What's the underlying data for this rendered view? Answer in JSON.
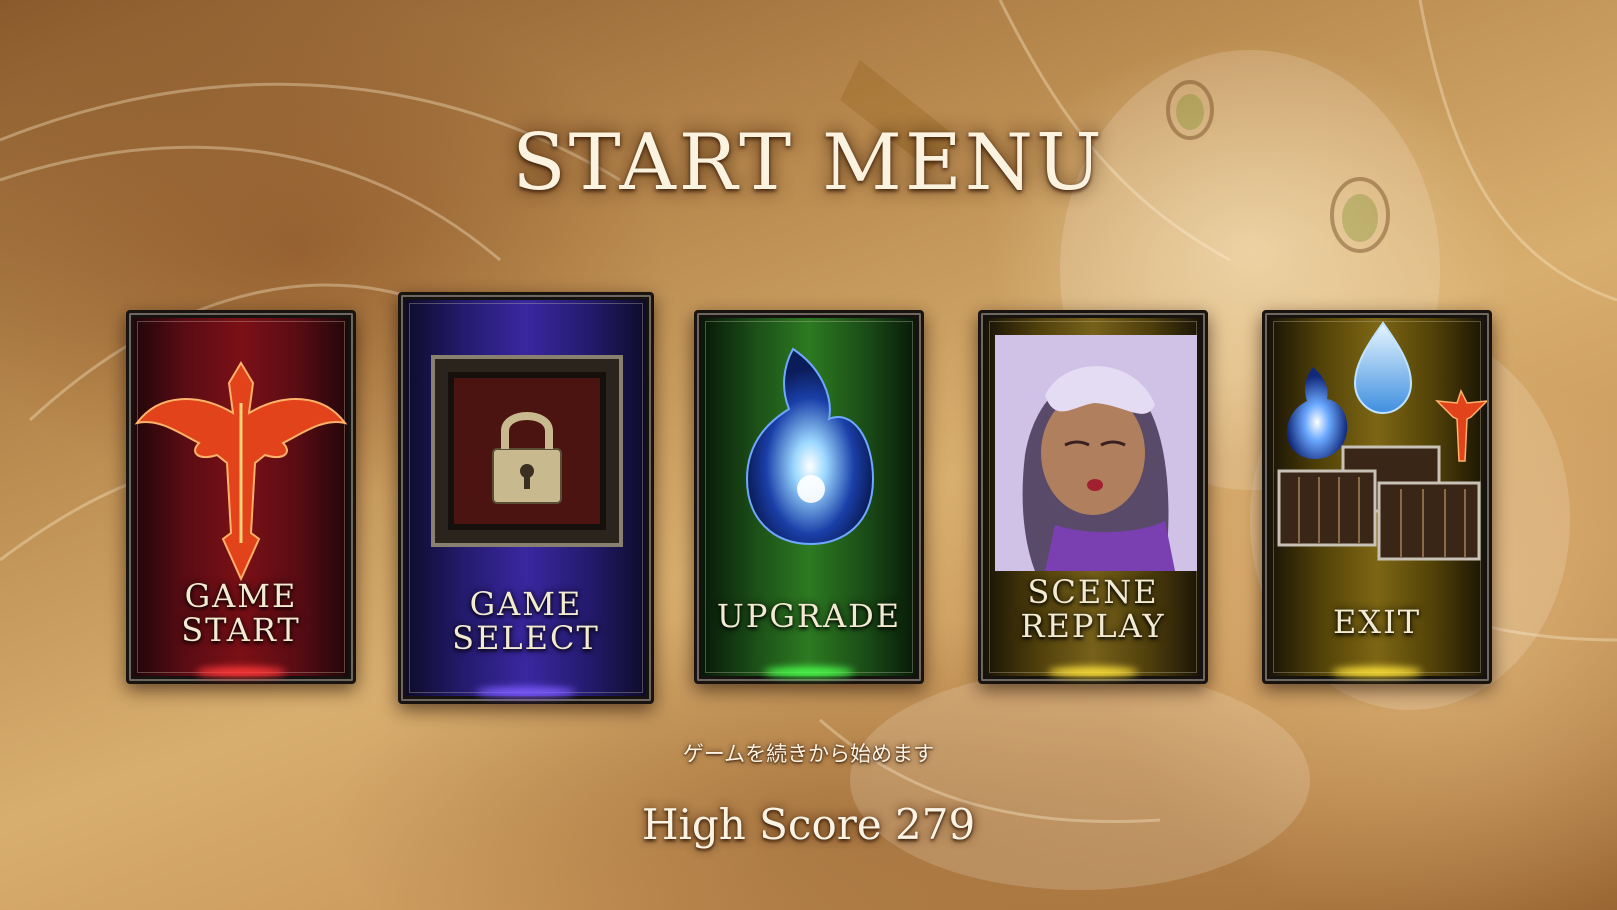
{
  "title": "START MENU",
  "cards": [
    {
      "id": "game-start",
      "label_lines": [
        "GAME",
        "START"
      ],
      "color": "#7b1016",
      "icon": "dragon-icon"
    },
    {
      "id": "game-select",
      "label_lines": [
        "GAME",
        "SELECT"
      ],
      "color": "#3a27a0",
      "icon": "locked-frame-icon"
    },
    {
      "id": "upgrade",
      "label_lines": [
        "UPGRADE"
      ],
      "color": "#2d7a22",
      "icon": "blue-crystal-icon"
    },
    {
      "id": "scene-replay",
      "label_lines": [
        "SCENE",
        "REPLAY"
      ],
      "color": "#77611a",
      "icon": "character-portrait"
    },
    {
      "id": "exit",
      "label_lines": [
        "EXIT"
      ],
      "color": "#7d6614",
      "icon": "treasure-chests-icon"
    }
  ],
  "hint_text": "ゲームを続きから始めます",
  "high_score": {
    "label": "High Score",
    "value": "279",
    "text": "High Score 279"
  }
}
